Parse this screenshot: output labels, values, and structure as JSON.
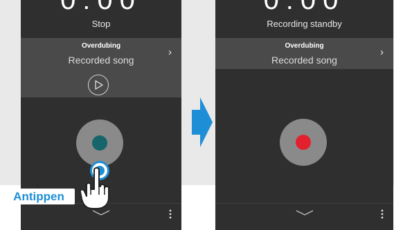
{
  "left_screen": {
    "timer": "0:00",
    "status": "Stop",
    "song_panel": {
      "overdub_label": "Overdubing",
      "song_label": "Recorded song",
      "chevron": "›"
    }
  },
  "right_screen": {
    "timer": "0:00",
    "status": "Recording standby",
    "song_panel": {
      "overdub_label": "Overdubing",
      "song_label": "Recorded song",
      "chevron": "›"
    }
  },
  "callout": {
    "label": "Antippen"
  },
  "colors": {
    "record_dot_standby": "#16656a",
    "record_dot_active": "#e3202d",
    "arrow": "#1e8fd6",
    "tap_highlight": "#1e8fd6"
  },
  "icons": {
    "play": "play-icon",
    "record": "record-icon",
    "chevron_down": "chevron-down-icon",
    "menu": "kebab-menu-icon",
    "hand": "tap-hand-icon",
    "arrow": "arrow-right-icon"
  }
}
